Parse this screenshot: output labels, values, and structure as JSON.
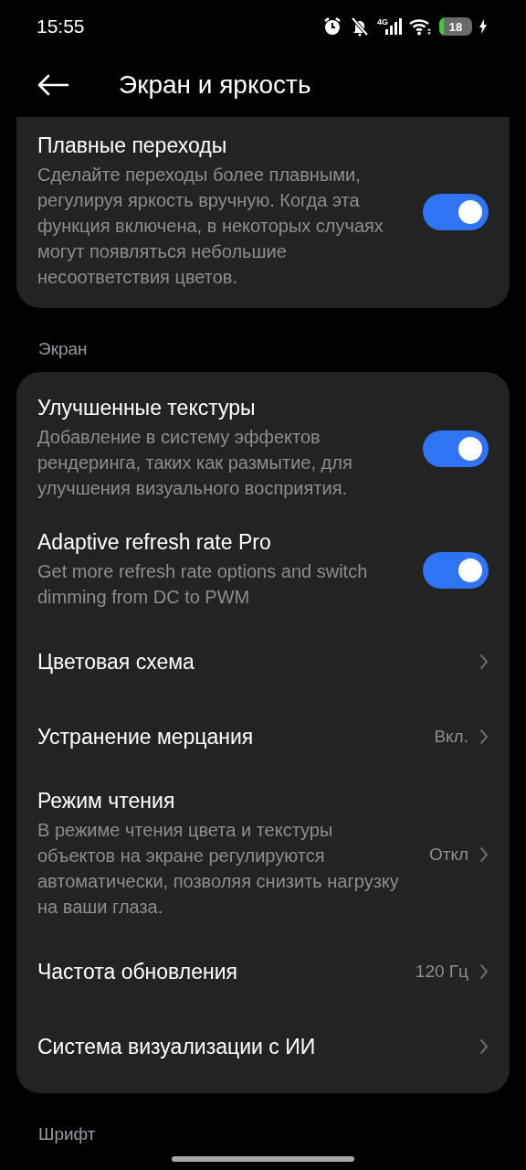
{
  "status_bar": {
    "time": "15:55",
    "network": "4G",
    "battery": "18",
    "charging": true
  },
  "header": {
    "title": "Экран и яркость"
  },
  "top_card": {
    "items": [
      {
        "kind": "toggle",
        "title": "Плавные переходы",
        "description": "Сделайте переходы более плавными, регулируя яркость вручную. Когда эта функция включена, в некоторых случаях могут появляться небольшие несоответствия цветов.",
        "on": true
      }
    ]
  },
  "sections": [
    {
      "title": "Экран",
      "items": [
        {
          "kind": "toggle",
          "title": "Улучшенные текстуры",
          "description": "Добавление в систему эффектов рендеринга, таких как размытие, для улучшения визуального восприятия.",
          "on": true
        },
        {
          "kind": "toggle",
          "title": "Adaptive refresh rate Pro",
          "description": "Get more refresh rate options and switch dimming from DC to PWM",
          "on": true
        },
        {
          "kind": "link",
          "title": "Цветовая схема"
        },
        {
          "kind": "link",
          "title": "Устранение мерцания",
          "value": "Вкл."
        },
        {
          "kind": "link",
          "title": "Режим чтения",
          "description": "В режиме чтения цвета и текстуры объектов на экране регулируются автоматически, позволяя снизить нагрузку на ваши глаза.",
          "value": "Откл"
        },
        {
          "kind": "link",
          "title": "Частота обновления",
          "value": "120 Гц"
        },
        {
          "kind": "link",
          "title": "Система визуализации с ИИ"
        }
      ]
    },
    {
      "title": "Шрифт"
    }
  ]
}
